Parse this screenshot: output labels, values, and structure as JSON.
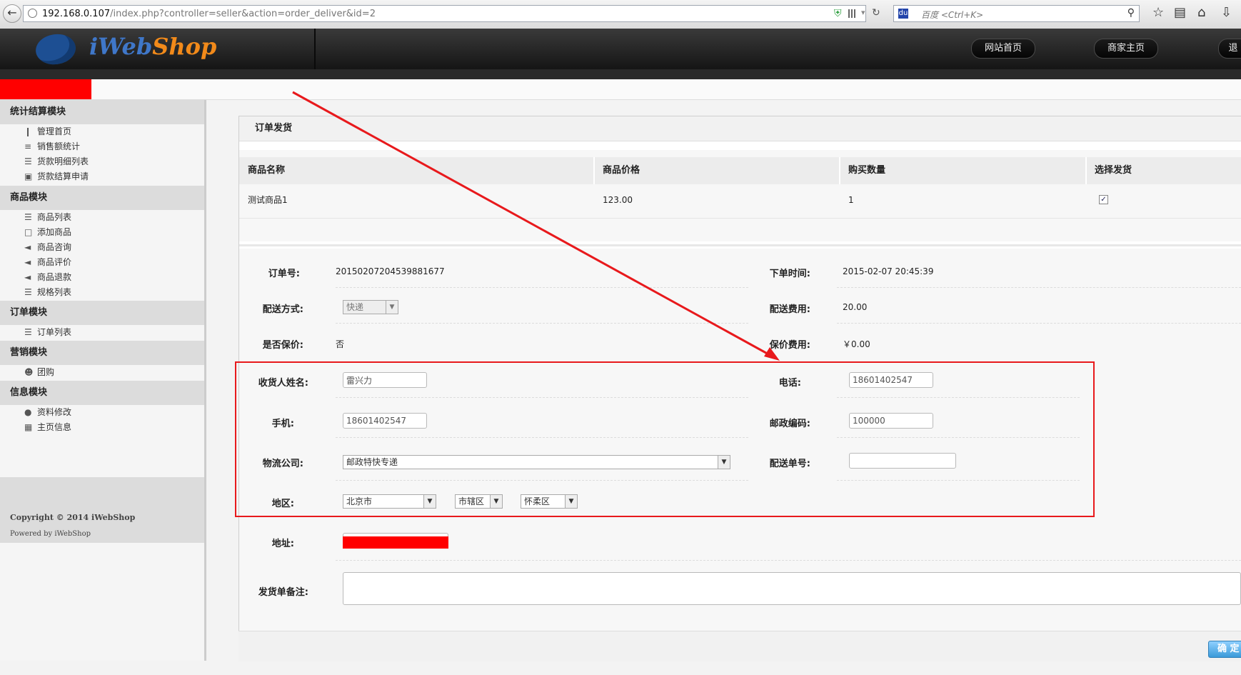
{
  "browser": {
    "url_host": "192.168.0.107",
    "url_path": "/index.php?controller=seller&action=order_deliver&id=2",
    "search_placeholder": "百度 <Ctrl+K>"
  },
  "header": {
    "logo_i": "i",
    "logo_web": "Web",
    "logo_shop": "Shop",
    "nav": [
      "网站首页",
      "商家主页",
      "退"
    ]
  },
  "sidebar": {
    "groups": [
      {
        "title": "统计结算模块",
        "items": [
          {
            "label": "管理首页",
            "icon": "bookmark-icon"
          },
          {
            "label": "销售额统计",
            "icon": "bars-icon"
          },
          {
            "label": "货款明细列表",
            "icon": "list-icon"
          },
          {
            "label": "货款结算申请",
            "icon": "briefcase-icon"
          }
        ]
      },
      {
        "title": "商品模块",
        "items": [
          {
            "label": "商品列表",
            "icon": "list-icon"
          },
          {
            "label": "添加商品",
            "icon": "add-doc-icon"
          },
          {
            "label": "商品咨询",
            "icon": "speaker-icon"
          },
          {
            "label": "商品评价",
            "icon": "speaker-icon"
          },
          {
            "label": "商品退款",
            "icon": "speaker-icon"
          },
          {
            "label": "规格列表",
            "icon": "list-icon"
          }
        ]
      },
      {
        "title": "订单模块",
        "items": [
          {
            "label": "订单列表",
            "icon": "list-icon"
          }
        ]
      },
      {
        "title": "营销模块",
        "items": [
          {
            "label": "团购",
            "icon": "users-icon"
          }
        ]
      },
      {
        "title": "信息模块",
        "items": [
          {
            "label": "资料修改",
            "icon": "user-icon"
          },
          {
            "label": "主页信息",
            "icon": "film-icon"
          }
        ]
      }
    ],
    "copyright": "Copyright © 2014 iWebShop",
    "powered": "Powered by iWebShop"
  },
  "main": {
    "title": "订单发货",
    "goods_table": {
      "headers": [
        "商品名称",
        "商品价格",
        "购买数量",
        "选择发货"
      ],
      "rows": [
        {
          "name": "测试商品1",
          "price": "123.00",
          "qty": "1",
          "selected": true
        }
      ]
    },
    "form": {
      "order_no_label": "订单号:",
      "order_no": "20150207204539881677",
      "order_time_label": "下单时间:",
      "order_time": "2015-02-07 20:45:39",
      "delivery_label": "配送方式:",
      "delivery": "快递",
      "delivery_fee_label": "配送费用:",
      "delivery_fee": "20.00",
      "insured_label": "是否保价:",
      "insured": "否",
      "insure_fee_label": "保价费用:",
      "insure_fee": "￥0.00",
      "receiver_label": "收货人姓名:",
      "receiver": "雷兴力",
      "phone_label": "电话:",
      "phone": "18601402547",
      "mobile_label": "手机:",
      "mobile": "18601402547",
      "zip_label": "邮政编码:",
      "zip": "100000",
      "logistics_label": "物流公司:",
      "logistics": "邮政特快专递",
      "waybill_label": "配送单号:",
      "waybill": "",
      "region_label": "地区:",
      "province": "北京市",
      "city": "市辖区",
      "district": "怀柔区",
      "address_label": "地址:",
      "remark_label": "发货单备注:",
      "remark": ""
    },
    "confirm_label": "确 定"
  },
  "colors": {
    "annotation_red": "#e8191c",
    "redaction": "#ff0000"
  }
}
